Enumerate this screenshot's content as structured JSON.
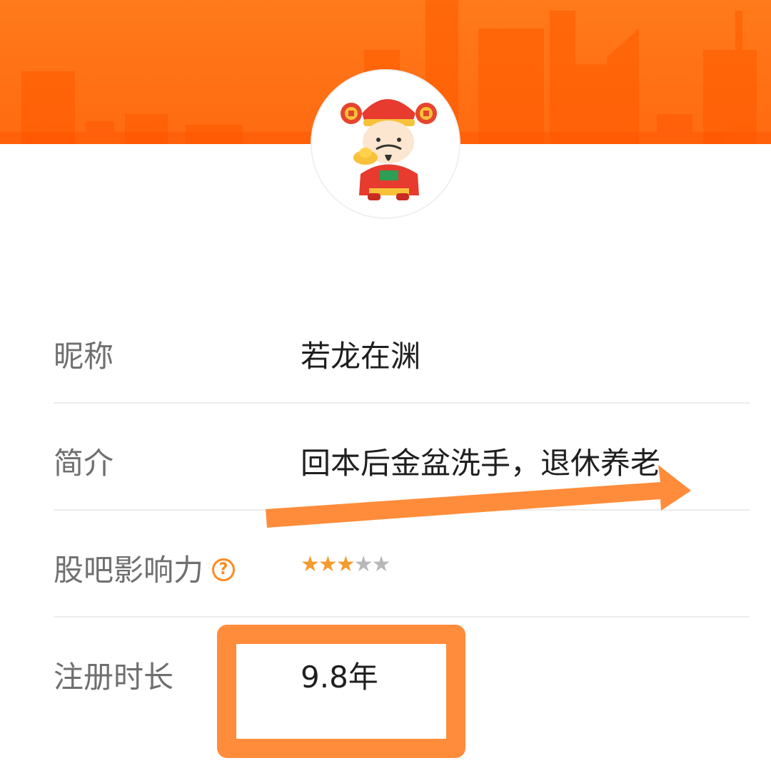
{
  "profile": {
    "nickname_label": "昵称",
    "nickname_value": "若龙在渊",
    "bio_label": "简介",
    "bio_value": "回本后金盆洗手，退休养老",
    "influence_label": "股吧影响力",
    "influence_help_icon": "?",
    "influence_rating": {
      "filled": 3,
      "total": 5
    },
    "registration_label": "注册时长",
    "registration_value": "9.8年"
  },
  "colors": {
    "brand_orange": "#ff6a10",
    "annotation_orange": "#ff8c3a",
    "star_filled": "#f39b2e",
    "star_empty": "#b8b8b8"
  },
  "icons": {
    "avatar": "caishen-god-of-wealth-avatar",
    "help": "question-circle-icon",
    "star": "star-icon"
  }
}
